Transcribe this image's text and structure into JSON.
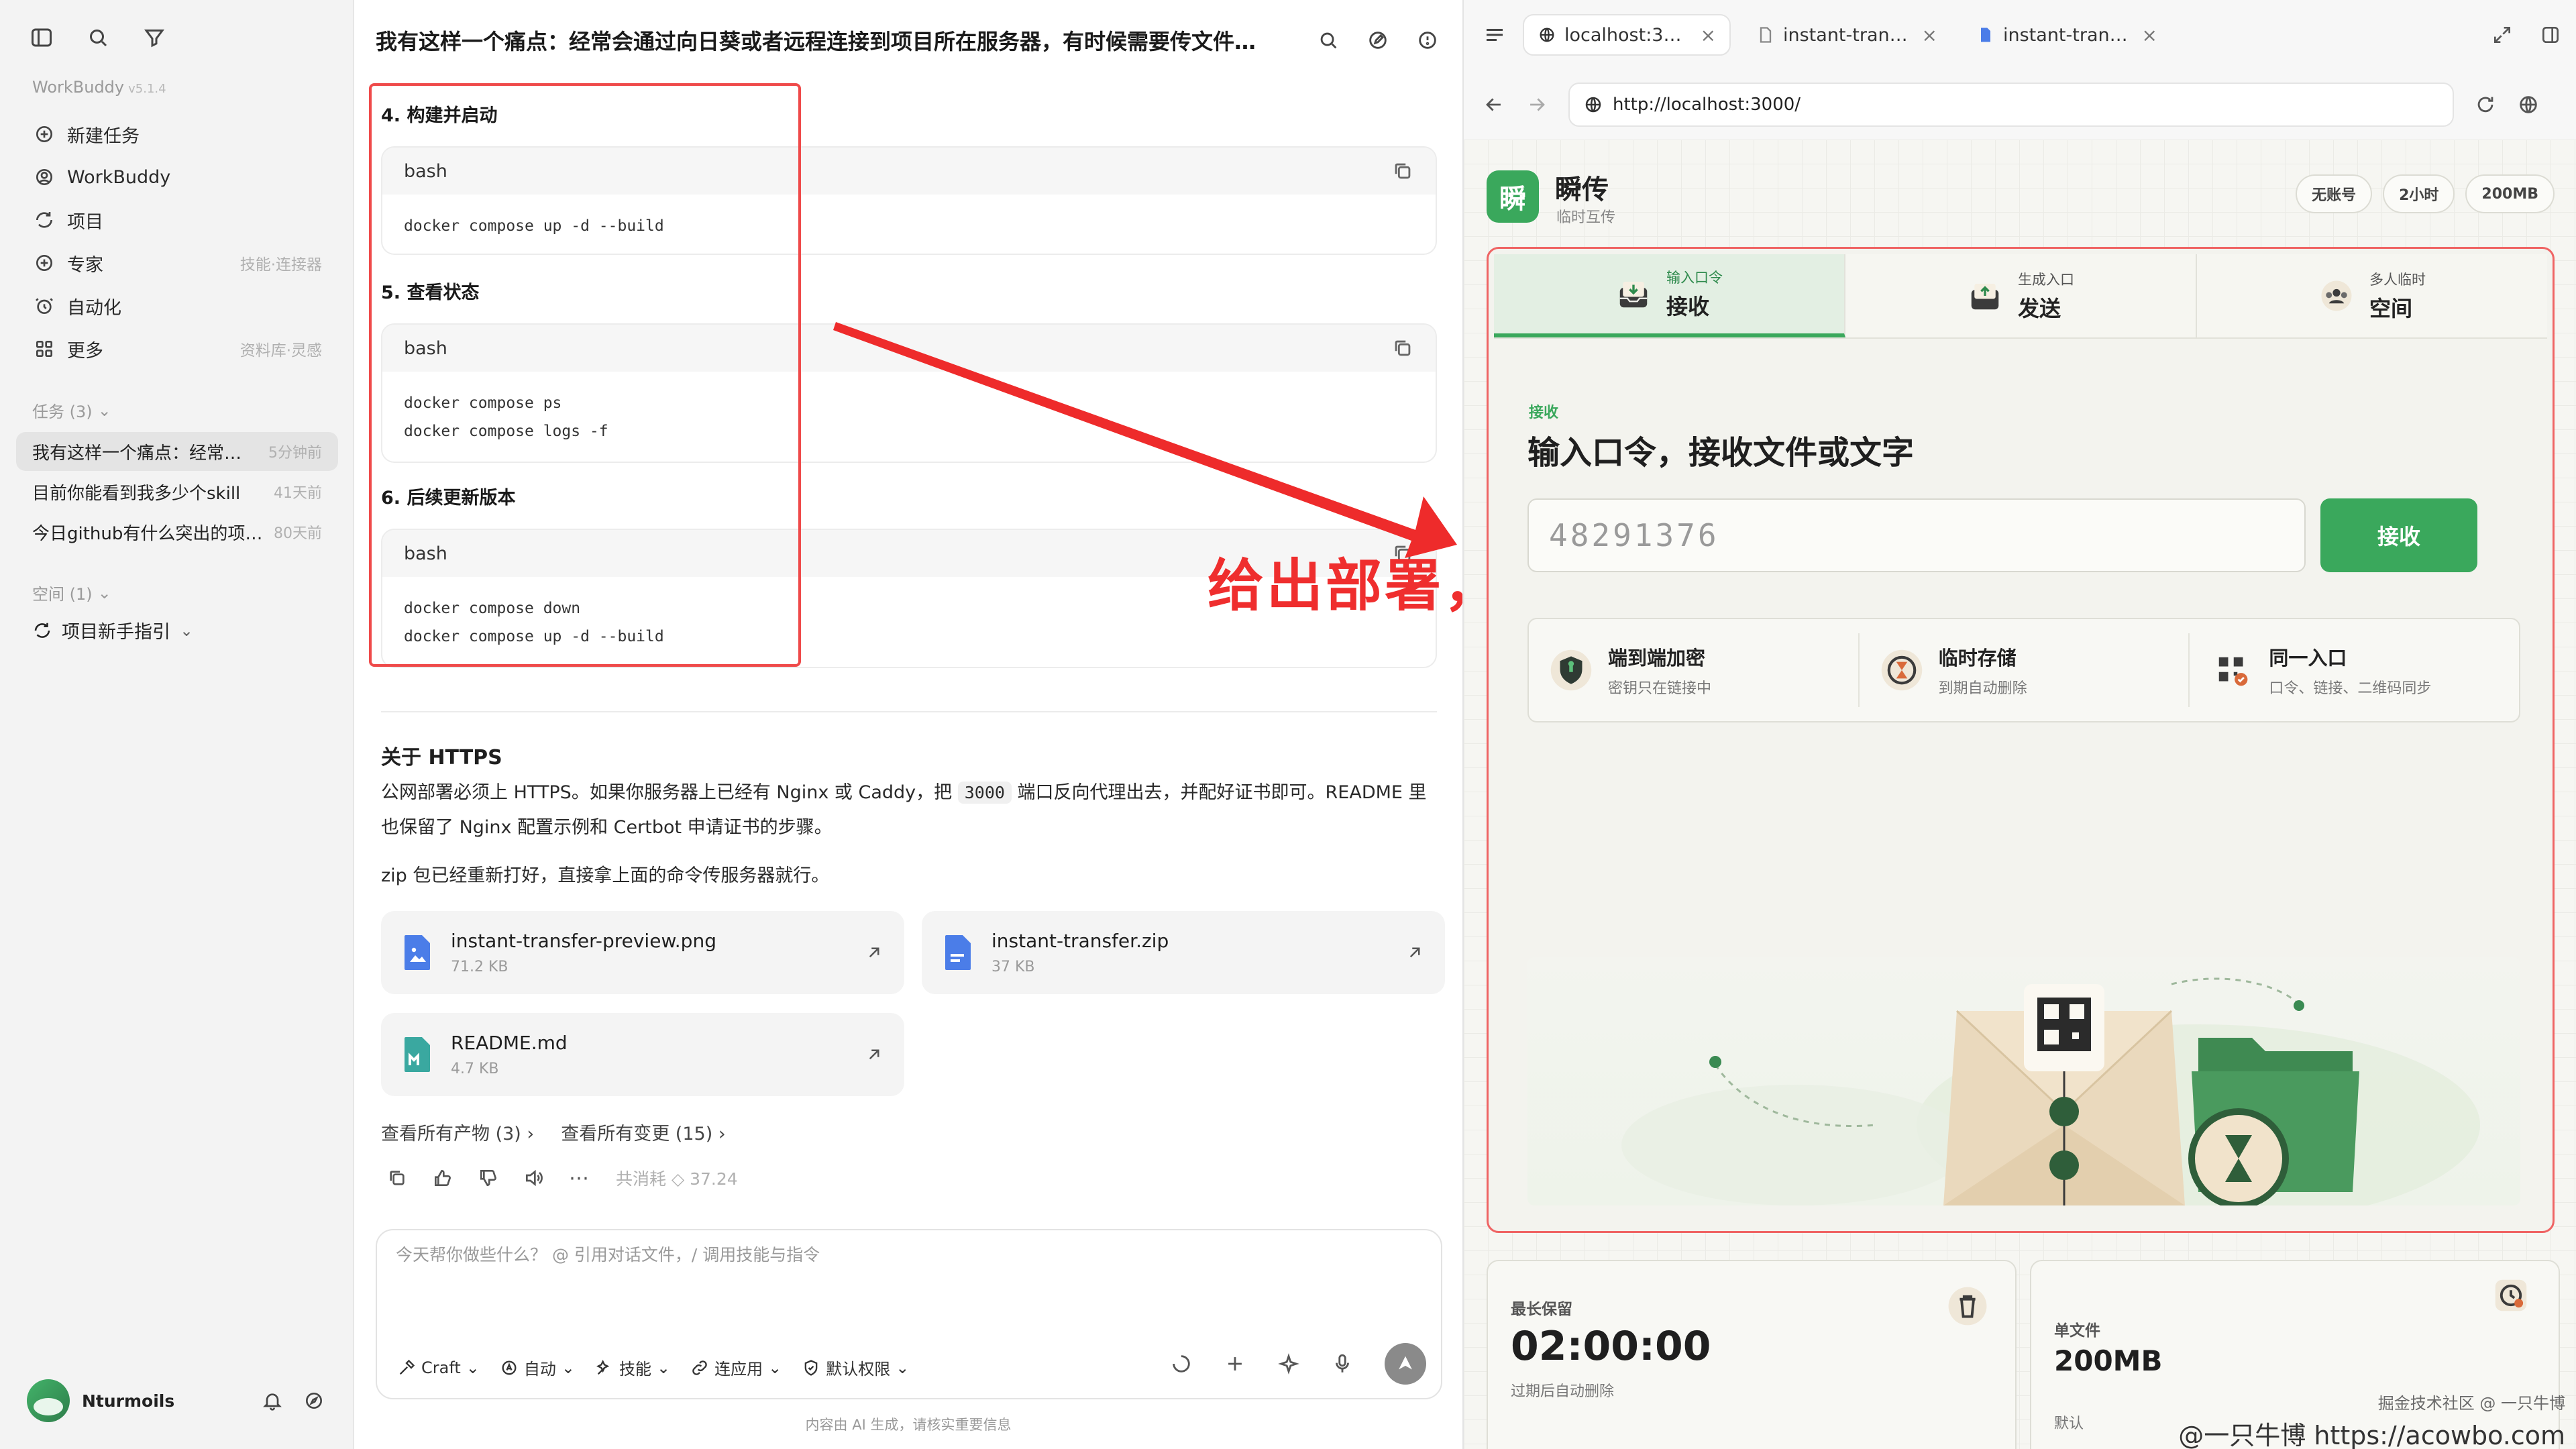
{
  "sidebar": {
    "app_name": "WorkBuddy",
    "version": "v5.1.4",
    "nav": [
      {
        "label": "新建任务",
        "meta": ""
      },
      {
        "label": "WorkBuddy",
        "meta": ""
      },
      {
        "label": "项目",
        "meta": ""
      },
      {
        "label": "专家",
        "meta": "技能·连接器"
      },
      {
        "label": "自动化",
        "meta": ""
      },
      {
        "label": "更多",
        "meta": "资料库·灵感"
      }
    ],
    "tasks_section": "任务 (3)",
    "tasks": [
      {
        "title": "我有这样一个痛点：经常…",
        "ago": "5分钟前"
      },
      {
        "title": "目前你能看到我多少个skill",
        "ago": "41天前"
      },
      {
        "title": "今日github有什么突出的项…",
        "ago": "80天前"
      }
    ],
    "spaces_section": "空间 (1)",
    "space_item": "项目新手指引",
    "user_name": "Nturmoils"
  },
  "chat": {
    "title": "我有这样一个痛点：经常会通过向日葵或者远程连接到项目所在服务器，有时候需要传文件…",
    "steps": [
      {
        "title": "4. 构建并启动",
        "lang": "bash",
        "lines": [
          "docker compose up -d --build"
        ]
      },
      {
        "title": "5. 查看状态",
        "lang": "bash",
        "lines": [
          "docker compose ps",
          "docker compose logs -f"
        ]
      },
      {
        "title": "6. 后续更新版本",
        "lang": "bash",
        "lines": [
          "docker compose down",
          "docker compose up -d --build"
        ]
      }
    ],
    "annotation": "给出部署，  最终效果",
    "https_title": "关于 HTTPS",
    "https_para_pre": "公网部署必须上 HTTPS。如果你服务器上已经有 Nginx 或 Caddy，把 ",
    "https_port": "3000",
    "https_para_post": " 端口反向代理出去，并配好证书即可。README 里也保留了 Nginx 配置示例和 Certbot 申请证书的步骤。",
    "zip_para": "zip 包已经重新打好，直接拿上面的命令传服务器就行。",
    "files": [
      {
        "name": "instant-transfer-preview.png",
        "size": "71.2 KB"
      },
      {
        "name": "instant-transfer.zip",
        "size": "37 KB"
      },
      {
        "name": "README.md",
        "size": "4.7 KB"
      }
    ],
    "view_outputs": "查看所有产物 (3)",
    "view_changes": "查看所有变更 (15)",
    "cost": "共消耗 ◇ 37.24",
    "composer_placeholder": "今天帮你做些什么？ @ 引用对话文件，/ 调用技能与指令",
    "tools": [
      "Craft",
      "自动",
      "技能",
      "连应用",
      "默认权限"
    ],
    "footnote": "内容由 AI 生成，请核实重要信息"
  },
  "browser": {
    "tabs": [
      {
        "label": "localhost:30…"
      },
      {
        "label": "instant-transf…"
      },
      {
        "label": "instant-transf…"
      }
    ],
    "url": "http://localhost:3000/"
  },
  "app": {
    "logo_char": "瞬",
    "name": "瞬传",
    "subtitle": "临时互传",
    "pills": [
      "无账号",
      "2小时",
      "200MB"
    ],
    "modes": [
      {
        "small": "输入口令",
        "big": "接收"
      },
      {
        "small": "生成入口",
        "big": "发送"
      },
      {
        "small": "多人临时",
        "big": "空间"
      }
    ],
    "section_tag": "接收",
    "section_title": "输入口令，接收文件或文字",
    "code_value": "48291376",
    "receive_button": "接收",
    "features": [
      {
        "title": "端到端加密",
        "desc": "密钥只在链接中"
      },
      {
        "title": "临时存储",
        "desc": "到期自动删除"
      },
      {
        "title": "同一入口",
        "desc": "口令、链接、二维码同步"
      }
    ],
    "stats": [
      {
        "label": "最长保留",
        "value": "02:00:00",
        "note": "过期后自动删除"
      },
      {
        "label": "单文件",
        "value": "200MB",
        "note": "默认"
      }
    ]
  },
  "watermark": {
    "line1": "掘金技术社区 @ 一只牛博",
    "line2": "@一只牛博 https://acowbo.com"
  },
  "colors": {
    "accent_green": "#3aa85c",
    "annotation_red": "#ef2e2e"
  }
}
